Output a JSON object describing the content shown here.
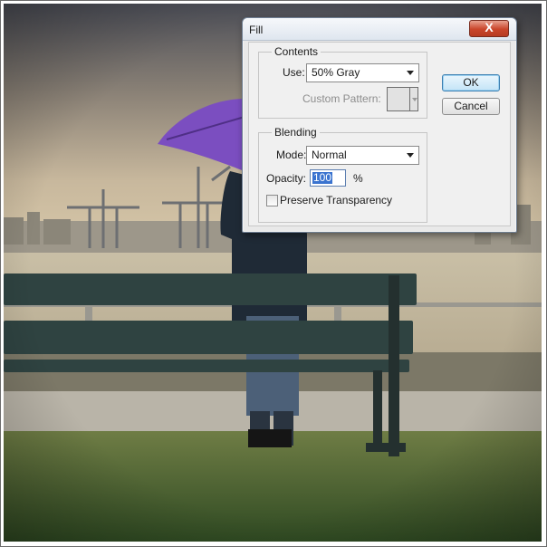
{
  "dialog": {
    "title": "Fill",
    "close_label": "X",
    "contents": {
      "legend": "Contents",
      "use_label": "Use:",
      "use_value": "50% Gray",
      "custom_pattern_label": "Custom Pattern:"
    },
    "blending": {
      "legend": "Blending",
      "mode_label": "Mode:",
      "mode_value": "Normal",
      "opacity_label": "Opacity:",
      "opacity_value": "100",
      "opacity_unit": "%",
      "preserve_transparency_label": "Preserve Transparency",
      "preserve_transparency_checked": false
    },
    "buttons": {
      "ok": "OK",
      "cancel": "Cancel"
    }
  },
  "colors": {
    "accent": "#3a73cf",
    "umbrella": "#7b4ec0",
    "grass": "#4a6a2e"
  }
}
